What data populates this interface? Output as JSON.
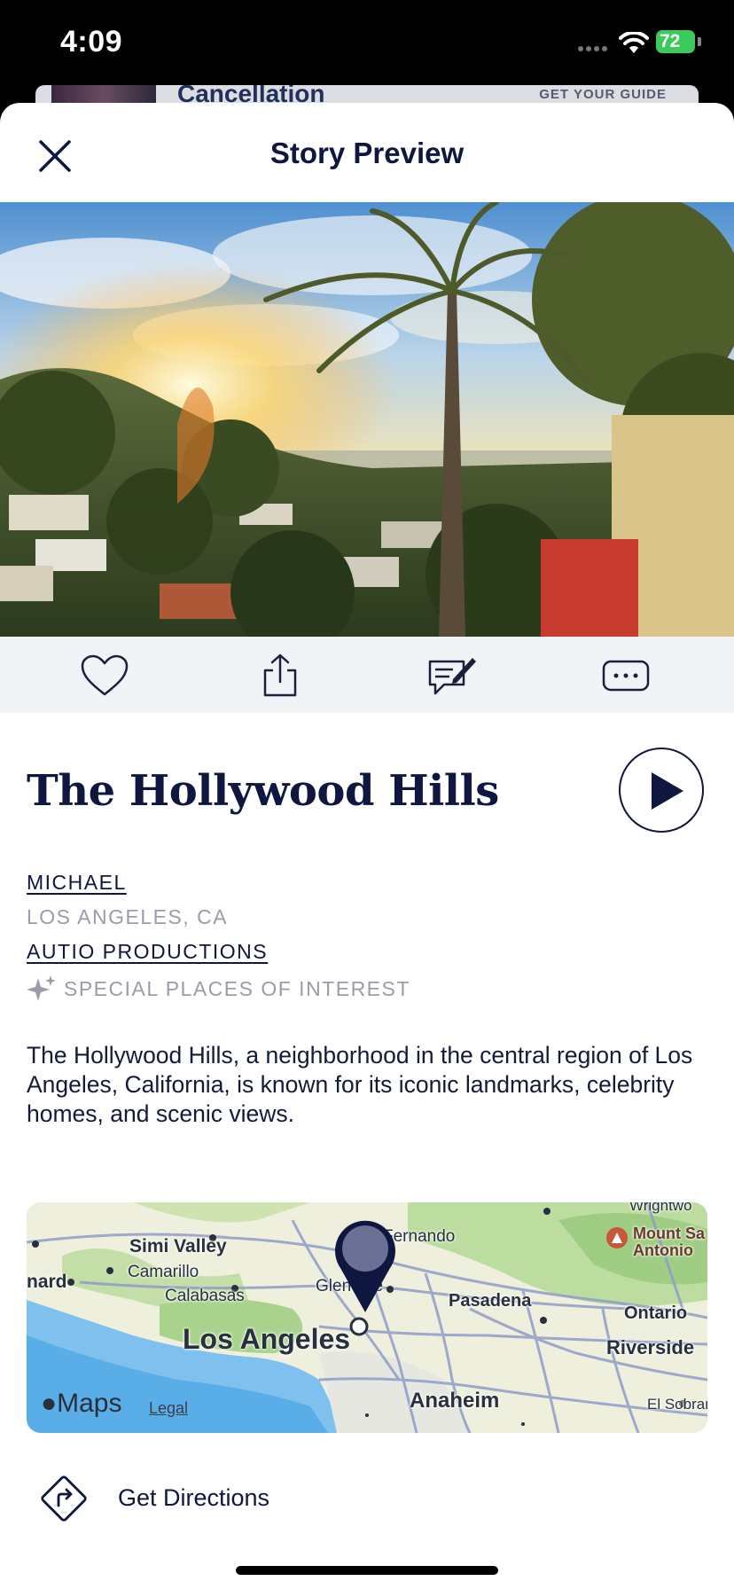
{
  "status": {
    "time": "4:09",
    "battery": "72"
  },
  "background": {
    "title": "Cancellation",
    "badge": "GET YOUR GUIDE"
  },
  "sheet": {
    "title": "Story Preview"
  },
  "story": {
    "title": "The Hollywood Hills",
    "author": "MICHAEL",
    "location": "LOS ANGELES, CA",
    "publisher": "AUTIO PRODUCTIONS",
    "category": "SPECIAL PLACES OF INTEREST",
    "description": "The Hollywood Hills, a neighborhood in the central region of Los Angeles, California, is known for its iconic landmarks, celebrity homes, and scenic views."
  },
  "actions": [
    {
      "icon": "heart-icon"
    },
    {
      "icon": "share-icon"
    },
    {
      "icon": "comment-edit-icon"
    },
    {
      "icon": "more-icon"
    }
  ],
  "map": {
    "labels": {
      "simi_valley": "Simi Valley",
      "camarillo": "Camarillo",
      "calabasas": "Calabasas",
      "los_angeles": "Los Angeles",
      "pasadena": "Pasadena",
      "ontario": "Ontario",
      "riverside": "Riverside",
      "anaheim": "Anaheim",
      "el_sobrante": "El Sobrante",
      "san_fernando": "Fernando",
      "glendale": "Glendale",
      "oxnard": "nard",
      "wrightwood": "Wrightwo",
      "mount_san_antonio": "Mount Sa\nAntonio"
    },
    "brand": "Maps",
    "legal": "Legal"
  },
  "directions": {
    "label": "Get Directions"
  },
  "colors": {
    "primary": "#0f1640",
    "muted": "#9a9cab",
    "actionbar": "#f2f3f6",
    "battery": "#3ccb5a"
  }
}
